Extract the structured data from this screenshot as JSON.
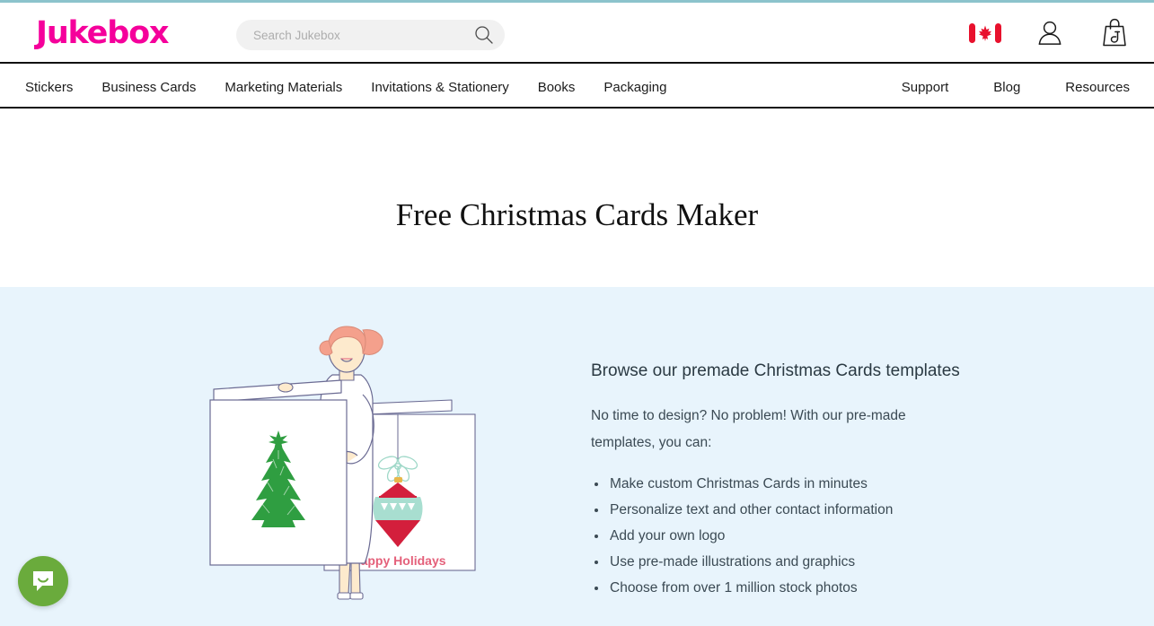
{
  "brand": {
    "logo_text": "Jukebox",
    "logo_color": "#f5009b"
  },
  "search": {
    "placeholder": "Search Jukebox",
    "value": "",
    "icon": "search-icon"
  },
  "header_icons": [
    {
      "name": "canada-flag-icon",
      "label": "Canada"
    },
    {
      "name": "user-account-icon",
      "label": "Account"
    },
    {
      "name": "shopping-bag-icon",
      "label": "Cart"
    }
  ],
  "nav": {
    "left_items": [
      {
        "label": "Stickers"
      },
      {
        "label": "Business Cards"
      },
      {
        "label": "Marketing Materials"
      },
      {
        "label": "Invitations & Stationery"
      },
      {
        "label": "Books"
      },
      {
        "label": "Packaging"
      }
    ],
    "right_items": [
      {
        "label": "Support"
      },
      {
        "label": "Blog"
      },
      {
        "label": "Resources"
      }
    ]
  },
  "hero": {
    "title": "Free Christmas Cards Maker"
  },
  "promo": {
    "heading": "Browse our premade Christmas Cards templates",
    "paragraph": "No time to design? No problem! With our pre-made templates, you can:",
    "bullets": [
      "Make custom Christmas Cards in minutes",
      "Personalize text and other contact information",
      "Add your own logo",
      "Use pre-made illustrations and graphics",
      "Choose from over 1 million stock photos"
    ]
  },
  "illustration": {
    "name": "woman-holding-christmas-card-illustration",
    "card_front_graphic": "christmas-tree",
    "card_back_graphic": "ornament",
    "card_back_text": "Happy Holidays",
    "colors": {
      "section_background": "#e8f4fc",
      "tree_green": "#2f9e41",
      "ornament_red": "#d31f3c",
      "ornament_teal": "#a8ded0",
      "hair_coral": "#f4a08c",
      "skin_cream": "#fdeacd",
      "greeting_pink": "#e4607a",
      "outline_purple": "#6b6b93"
    }
  },
  "chat": {
    "name": "chat-widget-button",
    "color": "#6aab3c",
    "label": "Open chat"
  }
}
